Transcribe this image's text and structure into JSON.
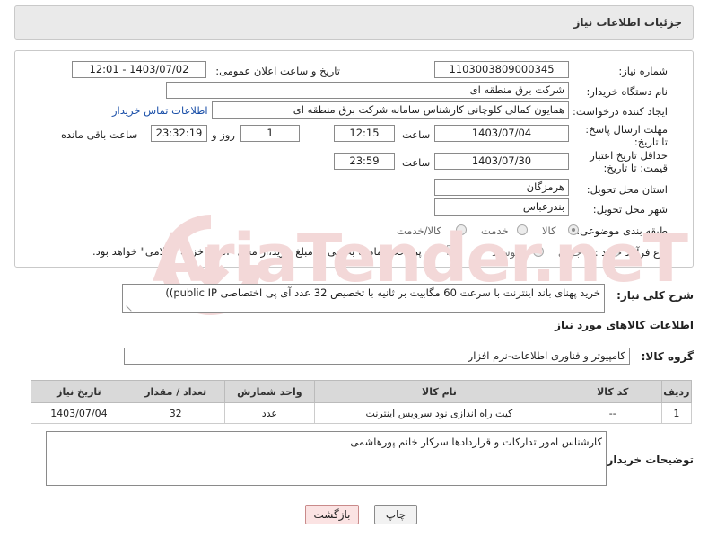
{
  "header": {
    "title": "جزئیات اطلاعات نیاز"
  },
  "fields": {
    "need_number_label": "شماره نیاز:",
    "need_number": "1103003809000345",
    "announce_label": "تاریخ و ساعت اعلان عمومی:",
    "announce_value": "1403/07/02 - 12:01",
    "buyer_org_label": "نام دستگاه خریدار:",
    "buyer_org": "شرکت برق منطقه ای",
    "creator_label": "ایجاد کننده درخواست:",
    "creator": "همایون کمالی کلوچانی کارشناس سامانه شرکت برق منطقه ای",
    "contact_link": "اطلاعات تماس خریدار",
    "deadline_label": "مهلت ارسال پاسخ: تا تاریخ:",
    "deadline_date": "1403/07/04",
    "time_label": "ساعت",
    "deadline_time": "12:15",
    "days_count": "1",
    "days_label": "روز و",
    "remaining_time": "23:32:19",
    "remaining_label": "ساعت باقی مانده",
    "validity_label": "حداقل تاریخ اعتبار قیمت: تا تاریخ:",
    "validity_date": "1403/07/30",
    "validity_time": "23:59",
    "province_label": "استان محل تحویل:",
    "province": "هرمزگان",
    "city_label": "شهر محل تحویل:",
    "city": "بندرعباس",
    "category_label": "طبقه بندی موضوعی:",
    "category_goods": "کالا",
    "category_service": "خدمت",
    "category_goods_service": "کالا/خدمت",
    "process_label": "نوع فرآیند خرید :",
    "process_partial": "جزیی",
    "process_medium": "متوسط",
    "payment_note": "پرداخت تمام یا بخشی از مبلغ خرید،از محل \"اسناد خزانه اسلامی\" خواهد بود."
  },
  "description": {
    "label": "شرح کلی نیاز:",
    "text": "خرید پهنای باند اینترنت با سرعت 60 مگابیت بر ثانیه با تخصیص 32 عدد آی پی اختصاصی public IP))"
  },
  "goods": {
    "section_title": "اطلاعات کالاهای مورد نیاز",
    "group_label": "گروه کالا:",
    "group_value": "کامپیوتر و فناوری اطلاعات-نرم افزار",
    "columns": [
      "ردیف",
      "کد کالا",
      "نام کالا",
      "واحد شمارش",
      "تعداد / مقدار",
      "تاریخ نیاز"
    ],
    "rows": [
      [
        "1",
        "--",
        "کیت راه اندازی نود سرویس اینترنت",
        "عدد",
        "32",
        "1403/07/04"
      ]
    ]
  },
  "buyer_notes": {
    "label": "توضیحات خریدار:",
    "text": "کارشناس امور تدارکات و قراردادها سرکار خانم پورهاشمی"
  },
  "buttons": {
    "print": "چاپ",
    "back": "بازگشت"
  },
  "watermark": {
    "text": "AriaTender.neT"
  },
  "colors": {
    "link": "#1a4fa8",
    "header_bg": "#eaeaea",
    "back_button": "#fbe3e3",
    "watermark": "#f3d8d8"
  }
}
